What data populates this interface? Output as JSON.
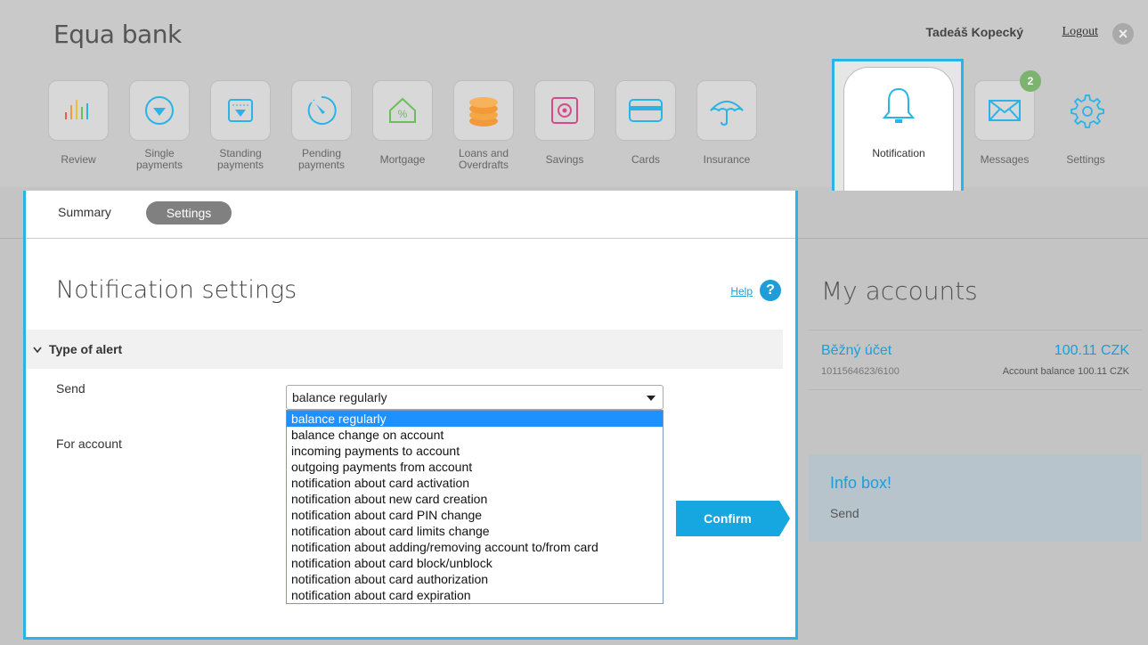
{
  "header": {
    "logo": "Equa bank",
    "user_name": "Tadeáš Kopecký",
    "logout": "Logout"
  },
  "nav": [
    {
      "label1": "Review",
      "label2": "",
      "icon": "bar-chart-icon"
    },
    {
      "label1": "Single",
      "label2": "payments",
      "icon": "circle-arrow-down-icon"
    },
    {
      "label1": "Standing",
      "label2": "payments",
      "icon": "calendar-arrow-icon"
    },
    {
      "label1": "Pending",
      "label2": "payments",
      "icon": "clock-dial-icon"
    },
    {
      "label1": "Mortgage",
      "label2": "",
      "icon": "house-percent-icon"
    },
    {
      "label1": "Loans and",
      "label2": "Overdrafts",
      "icon": "coins-stack-icon"
    },
    {
      "label1": "Savings",
      "label2": "",
      "icon": "safe-icon"
    },
    {
      "label1": "Cards",
      "label2": "",
      "icon": "card-icon"
    },
    {
      "label1": "Insurance",
      "label2": "",
      "icon": "umbrella-icon"
    }
  ],
  "notification_tab": {
    "label": "Notification",
    "icon": "bell-icon"
  },
  "messages_tab": {
    "label": "Messages",
    "badge": "2",
    "icon": "envelope-icon"
  },
  "settings_tab": {
    "label": "Settings",
    "icon": "gear-icon"
  },
  "subtabs": {
    "summary": "Summary",
    "settings": "Settings"
  },
  "main": {
    "title": "Notification settings",
    "help": "Help",
    "section": "Type of alert",
    "send_label": "Send",
    "account_label": "For account",
    "confirm": "Confirm"
  },
  "select": {
    "value": "balance regularly",
    "options": [
      "balance regularly",
      "balance change on account",
      "incoming payments to account",
      "outgoing payments from account",
      "notification about card activation",
      "notification about new card creation",
      "notification about card PIN change",
      "notification about card limits change",
      "notification about adding/removing account to/from card",
      "notification about card block/unblock",
      "notification about card authorization",
      "notification about card expiration"
    ]
  },
  "accounts": {
    "title": "My accounts",
    "name": "Běžný účet",
    "amount": "100.11 CZK",
    "number": "1011564623/6100",
    "balance": "Account balance 100.11 CZK"
  },
  "info": {
    "title": "Info box!",
    "text": "Send"
  },
  "colors": {
    "accent": "#2ab3e6",
    "header_bg": "#c9c9c9",
    "page_bg": "#c4c4c4",
    "selected_option": "#1e90ff"
  }
}
